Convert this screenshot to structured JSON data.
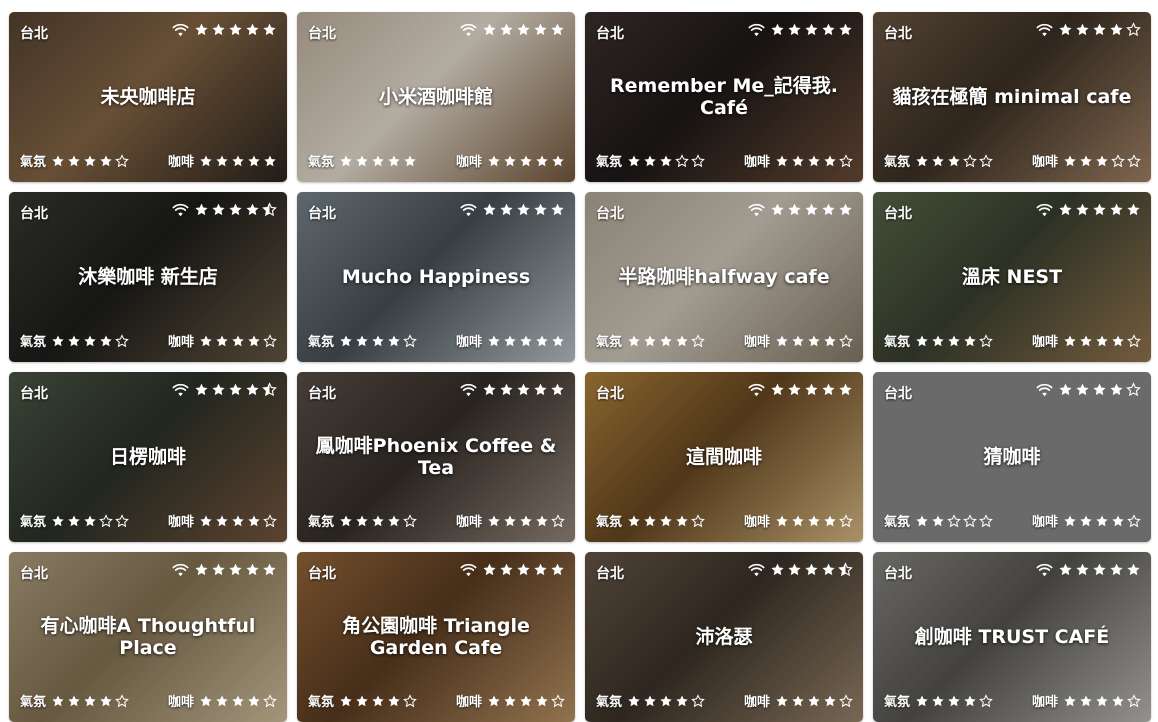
{
  "labels": {
    "ambience": "氣氛",
    "coffee": "咖啡"
  },
  "cards": [
    {
      "city": "台北",
      "name": "未央咖啡店",
      "wifi": 5,
      "ambience": 4,
      "coffee": 5,
      "bg": [
        "#5a4634",
        "#2e2620",
        "#8a6a48"
      ]
    },
    {
      "city": "台北",
      "name": "小米酒咖啡館",
      "wifi": 5,
      "ambience": 5,
      "coffee": 5,
      "bg": [
        "#c7b9a6",
        "#7a5c3e",
        "#efe6d8"
      ]
    },
    {
      "city": "台北",
      "name": "Remember Me_記得我. Café",
      "wifi": 5,
      "ambience": 3,
      "coffee": 4,
      "bg": [
        "#3e3230",
        "#6e4f3a",
        "#1f1a19"
      ]
    },
    {
      "city": "台北",
      "name": "貓孩在極簡 minimal cafe",
      "wifi": 4,
      "ambience": 3,
      "coffee": 3,
      "bg": [
        "#6e5844",
        "#a9896a",
        "#3e3226"
      ]
    },
    {
      "city": "台北",
      "name": "沐樂咖啡 新生店",
      "wifi": 4.5,
      "ambience": 4,
      "coffee": 4,
      "bg": [
        "#3b3a34",
        "#6b5b45",
        "#1e1e1b"
      ]
    },
    {
      "city": "台北",
      "name": "Mucho Happiness",
      "wifi": 5,
      "ambience": 4,
      "coffee": 5,
      "bg": [
        "#7e8a92",
        "#c3ccd0",
        "#4b545a"
      ]
    },
    {
      "city": "台北",
      "name": "半路咖啡halfway cafe",
      "wifi": 5,
      "ambience": 4,
      "coffee": 4,
      "bg": [
        "#b8ae9e",
        "#8c7f6e",
        "#d8d0c2"
      ]
    },
    {
      "city": "台北",
      "name": "溫床 NEST",
      "wifi": 5,
      "ambience": 4,
      "coffee": 4,
      "bg": [
        "#5b6a4a",
        "#9a7a52",
        "#3c4232"
      ]
    },
    {
      "city": "台北",
      "name": "日楞咖啡",
      "wifi": 4.5,
      "ambience": 3,
      "coffee": 4,
      "bg": [
        "#4e5a48",
        "#7b5a40",
        "#2d332a"
      ]
    },
    {
      "city": "台北",
      "name": "鳳咖啡Phoenix Coffee & Tea",
      "wifi": 5,
      "ambience": 4,
      "coffee": 4,
      "bg": [
        "#5d524a",
        "#9d8e80",
        "#37302b"
      ]
    },
    {
      "city": "台北",
      "name": "這間咖啡",
      "wifi": 5,
      "ambience": 4,
      "coffee": 4,
      "bg": [
        "#b7873f",
        "#e2c28a",
        "#6b4a22"
      ]
    },
    {
      "city": "台北",
      "name": "猜咖啡",
      "wifi": 4,
      "ambience": 2,
      "coffee": 4,
      "bg": [
        "#8e8e8e",
        "#8e8e8e",
        "#8e8e8e"
      ]
    },
    {
      "city": "台北",
      "name": "有心咖啡A Thoughtful Place",
      "wifi": 5,
      "ambience": 4,
      "coffee": 4,
      "bg": [
        "#b7a484",
        "#d9c8a4",
        "#8a7656"
      ]
    },
    {
      "city": "台北",
      "name": "角公園咖啡 Triangle Garden Cafe",
      "wifi": 5,
      "ambience": 4,
      "coffee": 4,
      "bg": [
        "#9a6a3c",
        "#c39a6a",
        "#5e3e22"
      ]
    },
    {
      "city": "台北",
      "name": "沛洛瑟",
      "wifi": 4.5,
      "ambience": 4,
      "coffee": 4,
      "bg": [
        "#6a5a4a",
        "#a08a70",
        "#3e342a"
      ]
    },
    {
      "city": "台北",
      "name": "創咖啡 TRUST CAFÉ",
      "wifi": 5,
      "ambience": 4,
      "coffee": 4,
      "bg": [
        "#8c8a86",
        "#c4c2bc",
        "#5a5854"
      ]
    }
  ]
}
